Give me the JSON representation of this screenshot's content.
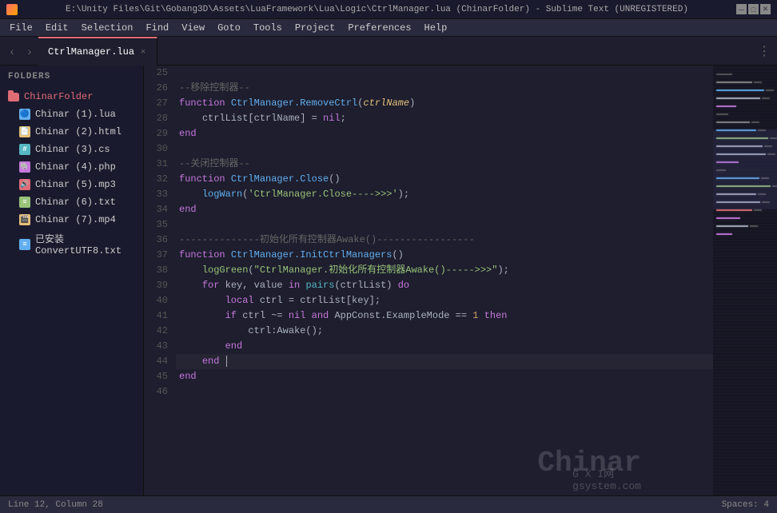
{
  "titleBar": {
    "path": "E:\\Unity Files\\Git\\Gobang3D\\Assets\\LuaFramework\\Lua\\Logic\\CtrlManager.lua (ChinarFolder) - Sublime Text (UNREGISTERED)",
    "appName": "Sublime Text (UNREGISTERED)"
  },
  "menuBar": {
    "items": [
      "File",
      "Edit",
      "Selection",
      "Find",
      "View",
      "Goto",
      "Tools",
      "Project",
      "Preferences",
      "Help"
    ]
  },
  "tabs": [
    {
      "label": "CtrlManager.lua",
      "active": true,
      "dirty": false
    }
  ],
  "sidebar": {
    "header": "FOLDERS",
    "folder": "ChinarFolder",
    "files": [
      {
        "name": "Chinar (1).lua",
        "type": "lua",
        "icon": "🔵"
      },
      {
        "name": "Chinar (2).html",
        "type": "html",
        "icon": "📄"
      },
      {
        "name": "Chinar (3).cs",
        "type": "cs",
        "icon": "#"
      },
      {
        "name": "Chinar (4).php",
        "type": "php",
        "icon": "🐘"
      },
      {
        "name": "Chinar (5).mp3",
        "type": "mp3",
        "icon": "🔊"
      },
      {
        "name": "Chinar (6).txt",
        "type": "txt",
        "icon": "📝"
      },
      {
        "name": "Chinar (7).mp4",
        "type": "mp4",
        "icon": "🎬"
      },
      {
        "name": "已安装ConvertUTF8.txt",
        "type": "utf8",
        "icon": "📝"
      }
    ]
  },
  "statusBar": {
    "position": "Line 12, Column 28",
    "spaces": "Spaces: 4"
  },
  "watermark": {
    "text": "Chinar",
    "subtext": "GXI网\ngsystem.com"
  }
}
